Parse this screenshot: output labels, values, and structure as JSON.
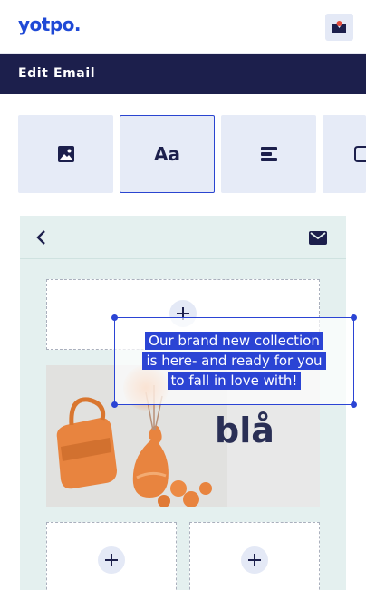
{
  "header": {
    "logo": "yotpo.",
    "notification_icon": "notification-bell-icon"
  },
  "title_bar": {
    "title": "Edit Email"
  },
  "blocks": {
    "items": [
      {
        "icon": "image-icon",
        "active": false
      },
      {
        "icon": "text-aa-icon",
        "label": "Aa",
        "active": true
      },
      {
        "icon": "align-left-icon",
        "active": false
      },
      {
        "icon": "square-icon",
        "active": false
      }
    ]
  },
  "editor": {
    "back_icon": "chevron-left-icon",
    "mail_icon": "envelope-icon",
    "hero_text": "blå",
    "text_block": {
      "lines": [
        "Our brand new collection",
        "is here- and ready for you",
        "to fall in love with!"
      ]
    }
  },
  "colors": {
    "brand_blue": "#1f49d6",
    "title_bar_bg": "#1c1f4c",
    "selection_blue": "#2b44d4",
    "tile_bg": "#e6ebf7",
    "panel_bg": "#e4f0ef",
    "orange": "#e8843f"
  }
}
